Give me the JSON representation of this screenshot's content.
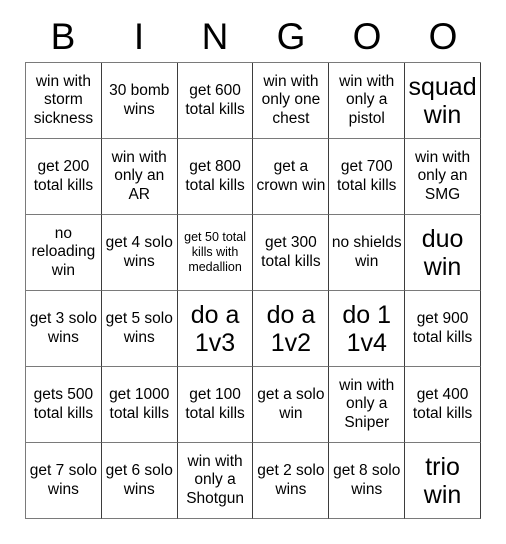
{
  "card": {
    "headers": [
      "B",
      "I",
      "N",
      "G",
      "O",
      "O"
    ],
    "rows": [
      [
        {
          "text": "win with storm sickness",
          "size": "md"
        },
        {
          "text": "30 bomb wins",
          "size": "md"
        },
        {
          "text": "get 600 total kills",
          "size": "md"
        },
        {
          "text": "win with only one chest",
          "size": "md"
        },
        {
          "text": "win with only a pistol",
          "size": "md"
        },
        {
          "text": "squad win",
          "size": "lg"
        }
      ],
      [
        {
          "text": "get 200 total kills",
          "size": "md"
        },
        {
          "text": "win with only an AR",
          "size": "md"
        },
        {
          "text": "get 800 total kills",
          "size": "md"
        },
        {
          "text": "get a crown win",
          "size": "md"
        },
        {
          "text": "get 700 total kills",
          "size": "md"
        },
        {
          "text": "win with only an SMG",
          "size": "md"
        }
      ],
      [
        {
          "text": "no reloading win",
          "size": "md"
        },
        {
          "text": "get 4 solo wins",
          "size": "md"
        },
        {
          "text": "get 50 total kills with medallion",
          "size": "sm"
        },
        {
          "text": "get 300 total kills",
          "size": "md"
        },
        {
          "text": "no shields win",
          "size": "md"
        },
        {
          "text": "duo win",
          "size": "lg"
        }
      ],
      [
        {
          "text": "get 3 solo wins",
          "size": "md"
        },
        {
          "text": "get 5 solo wins",
          "size": "md"
        },
        {
          "text": "do a 1v3",
          "size": "lg"
        },
        {
          "text": "do a 1v2",
          "size": "lg"
        },
        {
          "text": "do 1 1v4",
          "size": "lg"
        },
        {
          "text": "get 900 total kills",
          "size": "md"
        }
      ],
      [
        {
          "text": "gets 500 total kills",
          "size": "md"
        },
        {
          "text": "get 1000 total kills",
          "size": "md"
        },
        {
          "text": "get 100 total kills",
          "size": "md"
        },
        {
          "text": "get a solo win",
          "size": "md"
        },
        {
          "text": "win with only a Sniper",
          "size": "md"
        },
        {
          "text": "get 400 total kills",
          "size": "md"
        }
      ],
      [
        {
          "text": "get 7 solo wins",
          "size": "md"
        },
        {
          "text": "get 6 solo wins",
          "size": "md"
        },
        {
          "text": "win with only a Shotgun",
          "size": "md"
        },
        {
          "text": "get 2 solo wins",
          "size": "md"
        },
        {
          "text": "get 8 solo wins",
          "size": "md"
        },
        {
          "text": "trio win",
          "size": "lg"
        }
      ]
    ]
  },
  "colors": {
    "background": "#ffffff",
    "text": "#000000",
    "grid_line": "#7a7a7a",
    "grid_line_dark": "#3d3d3d"
  }
}
